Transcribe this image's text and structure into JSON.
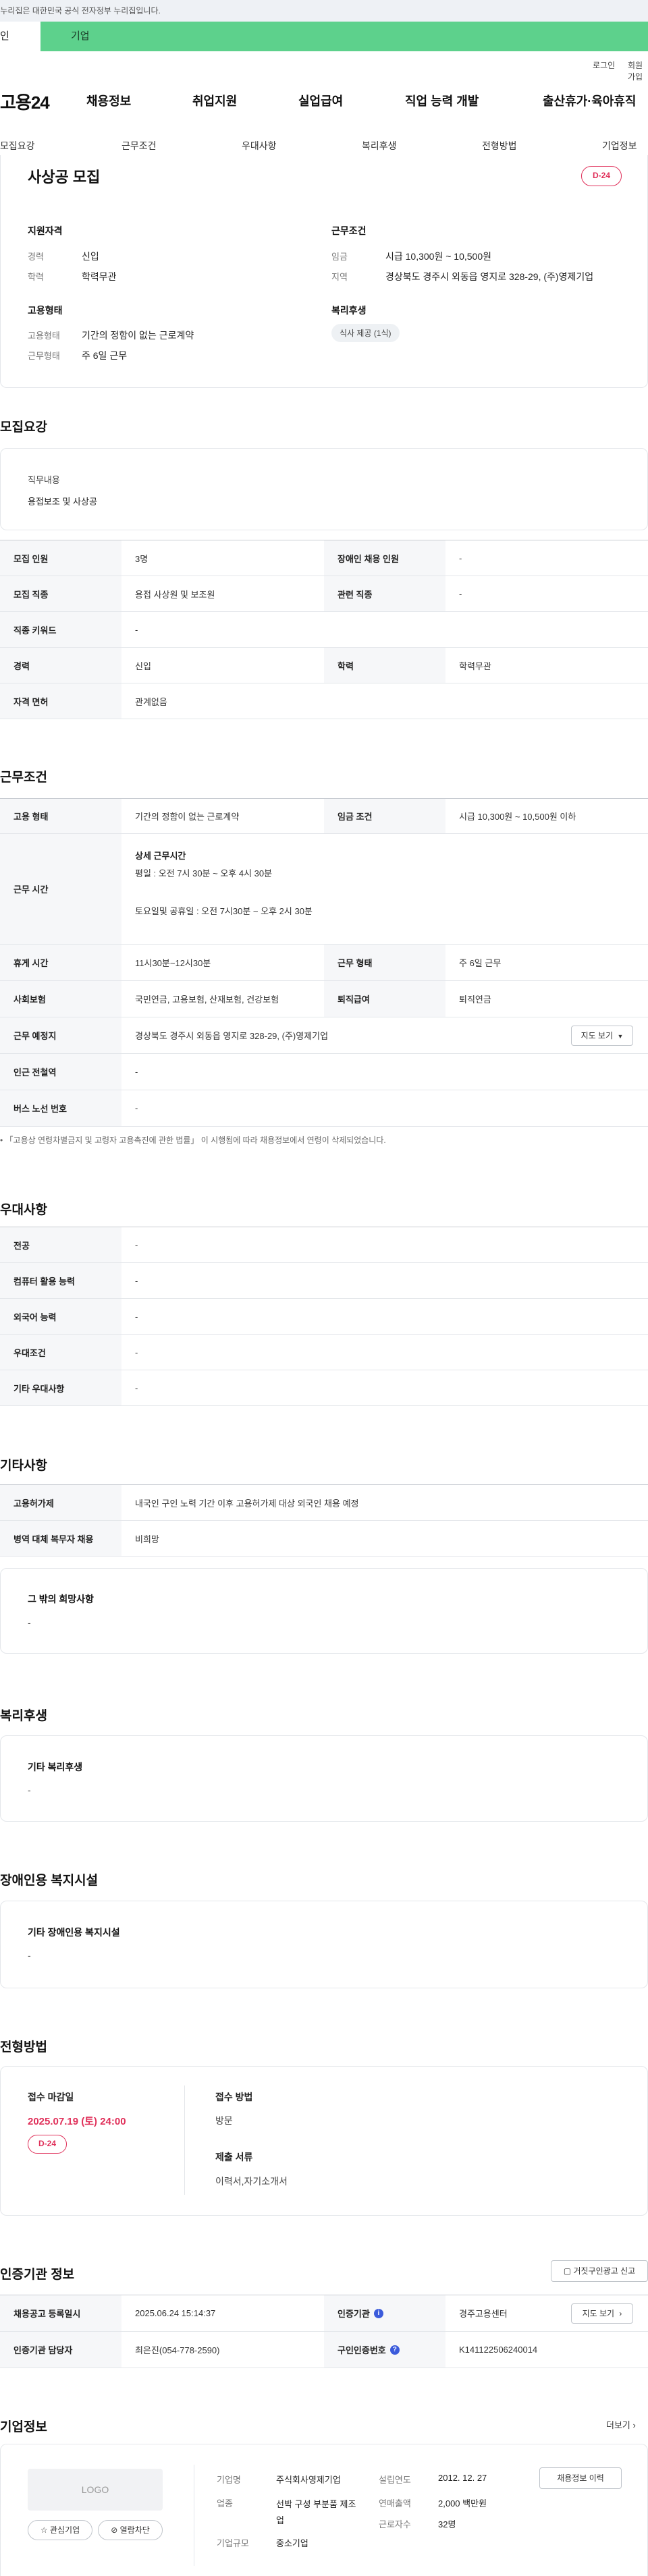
{
  "gov_bar": {
    "text": "이 누리집은 대한민국 공식 전자정부 누리집입니다."
  },
  "tabs": {
    "first": "인",
    "second": "기업"
  },
  "util": {
    "login": "로그인",
    "signup": "회원가입"
  },
  "gnb": {
    "logo": "고용24",
    "items": [
      "채용정보",
      "취업지원",
      "실업급여",
      "직업 능력 개발",
      "출산휴가·육아휴직"
    ]
  },
  "subnav": [
    "모집요강",
    "근무조건",
    "우대사항",
    "복리후생",
    "전형방법",
    "기업정보"
  ],
  "summary": {
    "title": "사상공 모집",
    "dday": "D-24",
    "qual_title": "지원자격",
    "qual": [
      {
        "k": "경력",
        "v": "신입"
      },
      {
        "k": "학력",
        "v": "학력무관"
      }
    ],
    "cond_title": "근무조건",
    "cond": [
      {
        "k": "임금",
        "v": "시급 10,300원 ~ 10,500원"
      },
      {
        "k": "지역",
        "v": "경상북도 경주시 외동읍 영지로 328-29, (주)영제기업"
      }
    ],
    "emp_title": "고용형태",
    "emp": [
      {
        "k": "고용형태",
        "v": "기간의 정함이 없는 근로계약"
      },
      {
        "k": "근무형태",
        "v": "주 6일 근무"
      }
    ],
    "welfare_title": "복리후생",
    "welfare_pill": "식사 제공 (1식)"
  },
  "recruit": {
    "heading": "모집요강",
    "duty_title": "직무내용",
    "duty_value": "용접보조 및 사상공",
    "rows": [
      {
        "l1": "모집 인원",
        "v1": "3명",
        "l2": "장애인 채용 인원",
        "v2": "-"
      },
      {
        "l1": "모집 직종",
        "v1": "용접 사상원 및 보조원",
        "l2": "관련 직종",
        "v2": "-"
      },
      {
        "l1": "직종 키워드",
        "v1": "-"
      },
      {
        "l1": "경력",
        "v1": "신입",
        "l2": "학력",
        "v2": "학력무관"
      },
      {
        "l1": "자격 면허",
        "v1": "관계없음"
      }
    ]
  },
  "work": {
    "heading": "근무조건",
    "emp_label": "고용 형태",
    "emp_val": "기간의 정함이 없는 근로계약",
    "wage_label": "임금 조건",
    "wage_val": "시급 10,300원 ~ 10,500원 이하",
    "time_label": "근무 시간",
    "time_title": "상세 근무시간",
    "time_line1": "평일 : 오전 7시 30분 ~ 오후 4시 30분",
    "time_line2": "토요일및 공휴일 : 오전 7시30분 ~ 오후 2시 30분",
    "break_label": "휴게 시간",
    "break_val": "11시30분~12시30분",
    "form_label": "근무 형태",
    "form_val": "주 6일 근무",
    "ins_label": "사회보험",
    "ins_val": "국민연금, 고용보험, 산재보험, 건강보험",
    "ret_label": "퇴직급여",
    "ret_val": "퇴직연금",
    "place_label": "근무 예정지",
    "place_val": "경상북도 경주시 외동읍 영지로 328-29, (주)영제기업",
    "map_btn": "지도 보기",
    "subway_label": "인근 전철역",
    "subway_val": "-",
    "bus_label": "버스 노선 번호",
    "bus_val": "-",
    "note": "「고용상 연령차별금지 및 고령자 고용촉진에 관한 법률」 이 시행됨에 따라 채용정보에서 연령이 삭제되었습니다."
  },
  "pref": {
    "heading": "우대사항",
    "rows": [
      {
        "l": "전공",
        "v": "-"
      },
      {
        "l": "컴퓨터 활용 능력",
        "v": "-"
      },
      {
        "l": "외국어 능력",
        "v": "-"
      },
      {
        "l": "우대조건",
        "v": "-"
      },
      {
        "l": "기타 우대사항",
        "v": "-"
      }
    ]
  },
  "etc": {
    "heading": "기타사항",
    "rows": [
      {
        "l": "고용허가제",
        "v": "내국인 구인 노력 기간 이후 고용허가제 대상 외국인 채용 예정"
      },
      {
        "l": "병역 대체 복무자 채용",
        "v": "비희망"
      }
    ],
    "box_title": "그 밖의 희망사항",
    "box_value": "-"
  },
  "welfare": {
    "heading": "복리후생",
    "box_title": "기타 복리후생",
    "box_value": "-"
  },
  "disabled": {
    "heading": "장애인용 복지시설",
    "box_title": "기타 장애인용 복지시설",
    "box_value": "-"
  },
  "process": {
    "heading": "전형방법",
    "deadline_label": "접수 마감일",
    "deadline_value": "2025.07.19 (토) 24:00",
    "dday": "D-24",
    "method_label": "접수 방법",
    "method_value": "방문",
    "docs_label": "제출 서류",
    "docs_value": "이력서,자기소개서"
  },
  "agency": {
    "heading": "인증기관 정보",
    "report_btn": "거짓구인광고 신고",
    "reg_label": "채용공고 등록일시",
    "reg_val": "2025.06.24 15:14:37",
    "org_label": "인증기관",
    "org_val": "경주고용센터",
    "map_btn": "지도 보기",
    "mgr_label": "인증기관 담당자",
    "mgr_val": "최은진(054-778-2590)",
    "no_label": "구인인증번호",
    "no_val": "K141122506240014"
  },
  "company": {
    "heading": "기업정보",
    "more": "더보기",
    "logo_text": "LOGO",
    "fav_btn": "관심기업",
    "block_btn": "열람차단",
    "name_label": "기업명",
    "name_val": "주식회사영제기업",
    "ind_label": "업종",
    "ind_val": "선박 구성 부분품 제조업",
    "size_label": "기업규모",
    "size_val": "중소기업",
    "found_label": "설립연도",
    "found_val": "2012. 12. 27",
    "sales_label": "연매출액",
    "sales_val": "2,000 백만원",
    "emp_label": "근로자수",
    "emp_val": "32명",
    "history_btn": "채용정보 이력"
  }
}
